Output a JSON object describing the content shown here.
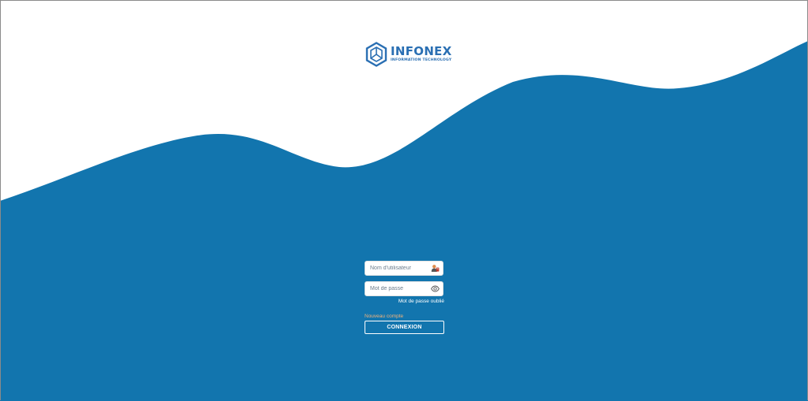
{
  "brand": {
    "name": "INFONEX",
    "tagline": "INFORMATION TECHNOLOGY",
    "color": "#2a6fb3"
  },
  "theme": {
    "wave_color": "#1275ae",
    "background": "#ffffff",
    "accent_link": "#f0b27a"
  },
  "login": {
    "username_placeholder": "Nom d'utilisateur",
    "username_value": "",
    "username_icon": "user-badge-icon",
    "password_placeholder": "Mot de passe",
    "password_value": "",
    "password_icon": "eye-icon",
    "forgot_label": "Mot de passe oublié",
    "new_account_label": "Nouveau compte",
    "submit_label": "CONNEXION"
  }
}
